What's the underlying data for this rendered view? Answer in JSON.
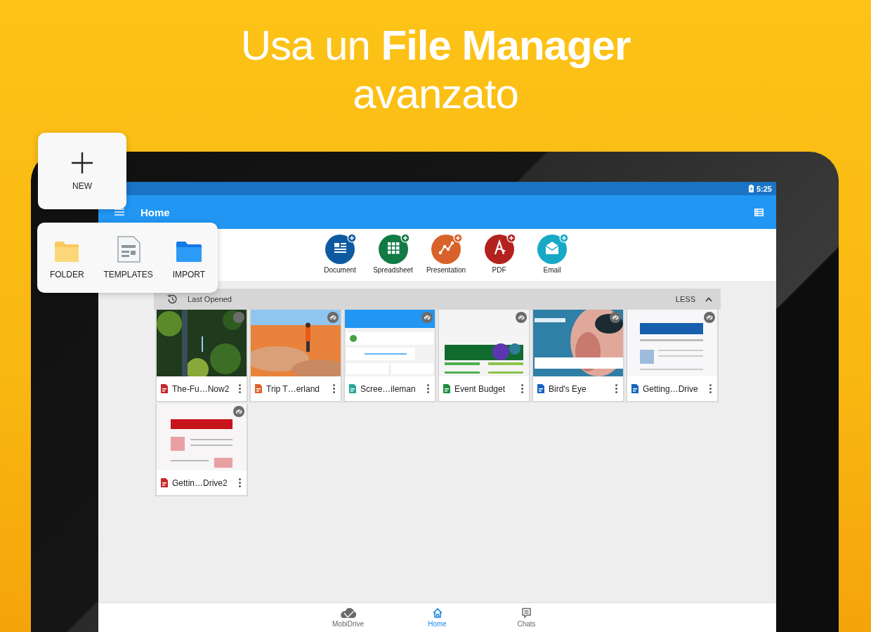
{
  "headline": {
    "line1": "Usa un **File Manager**",
    "line2": "avanzato"
  },
  "new_button": {
    "label": "NEW"
  },
  "new_menu": [
    {
      "label": "FOLDER",
      "kind": "folder"
    },
    {
      "label": "TEMPLATES",
      "kind": "templates"
    },
    {
      "label": "IMPORT",
      "kind": "import"
    }
  ],
  "status_bar": {
    "time": "5:25"
  },
  "app_bar": {
    "title": "Home"
  },
  "create": [
    {
      "label": "Document",
      "kind": "document"
    },
    {
      "label": "Spreadsheet",
      "kind": "spreadsheet"
    },
    {
      "label": "Presentation",
      "kind": "presentation"
    },
    {
      "label": "PDF",
      "kind": "pdf"
    },
    {
      "label": "Email",
      "kind": "email"
    }
  ],
  "recent": {
    "title": "Last Opened",
    "toggle": "LESS",
    "expanded": true,
    "files": [
      {
        "name": "The-Fu…Now2",
        "kind": "pdf",
        "synced": false
      },
      {
        "name": "Trip T…erland",
        "kind": "presentation",
        "synced": true
      },
      {
        "name": "Scree…ileman",
        "synced": true
      },
      {
        "name": "Event Budget",
        "kind": "spreadsheet",
        "synced": true
      },
      {
        "name": "Bird's Eye",
        "kind": "document",
        "synced": true
      },
      {
        "name": "Getting…Drive",
        "kind": "document",
        "synced": true
      },
      {
        "name": "Gettin…Drive2",
        "kind": "pdf",
        "synced": true
      }
    ]
  },
  "bottom_nav": [
    {
      "label": "MobiDrive",
      "kind": "drive",
      "selected": false
    },
    {
      "label": "Home",
      "kind": "home",
      "selected": true
    },
    {
      "label": "Chats",
      "kind": "chats",
      "selected": false
    }
  ]
}
